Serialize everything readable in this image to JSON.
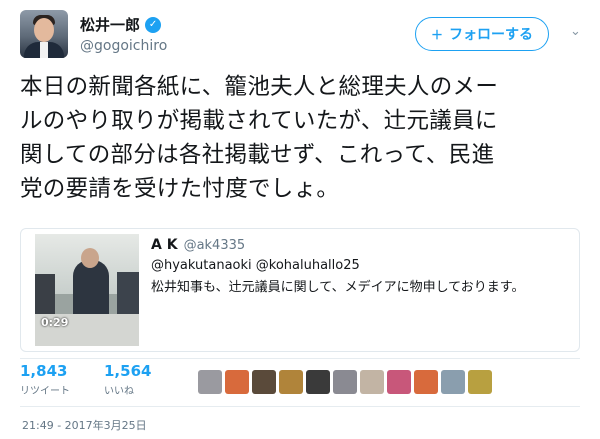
{
  "user": {
    "display_name": "松井一郎",
    "handle": "@gogoichiro",
    "verified_icon": "✓"
  },
  "follow_button": {
    "icon": "＋",
    "label": "フォローする"
  },
  "menu_chevron": "⌄",
  "tweet": {
    "lines": [
      "本日の新聞各紙に、籠池夫人と総理夫人のメー",
      "ルのやり取りが掲載されていたが、辻元議員に",
      "関しての部分は各社掲載せず、これって、民進",
      "党の要請を受けた忖度でしょ。"
    ]
  },
  "quoted_tweet": {
    "author_name": "A K",
    "author_handle": "@ak4335",
    "mentions": "@hyakutanaoki @kohaluhallo25",
    "text": "松井知事も、辻元議員に関して、メデイアに物申しております。",
    "media_time": "0:29"
  },
  "stats": {
    "retweets": {
      "count": "1,843",
      "label": "リツイート"
    },
    "likes": {
      "count": "1,564",
      "label": "いいね"
    }
  },
  "liker_colors": [
    "#9a9aa0",
    "#d86a3c",
    "#5a4a3a",
    "#b0843a",
    "#3a3a3a",
    "#8a8a92",
    "#c2b4a4",
    "#c8577a",
    "#d86a3c",
    "#8a9eae",
    "#b8a040"
  ],
  "timestamp": "21:49 - 2017年3月25日",
  "colors": {
    "accent": "#1da1f2",
    "text": "#14171a",
    "muted": "#657786"
  }
}
